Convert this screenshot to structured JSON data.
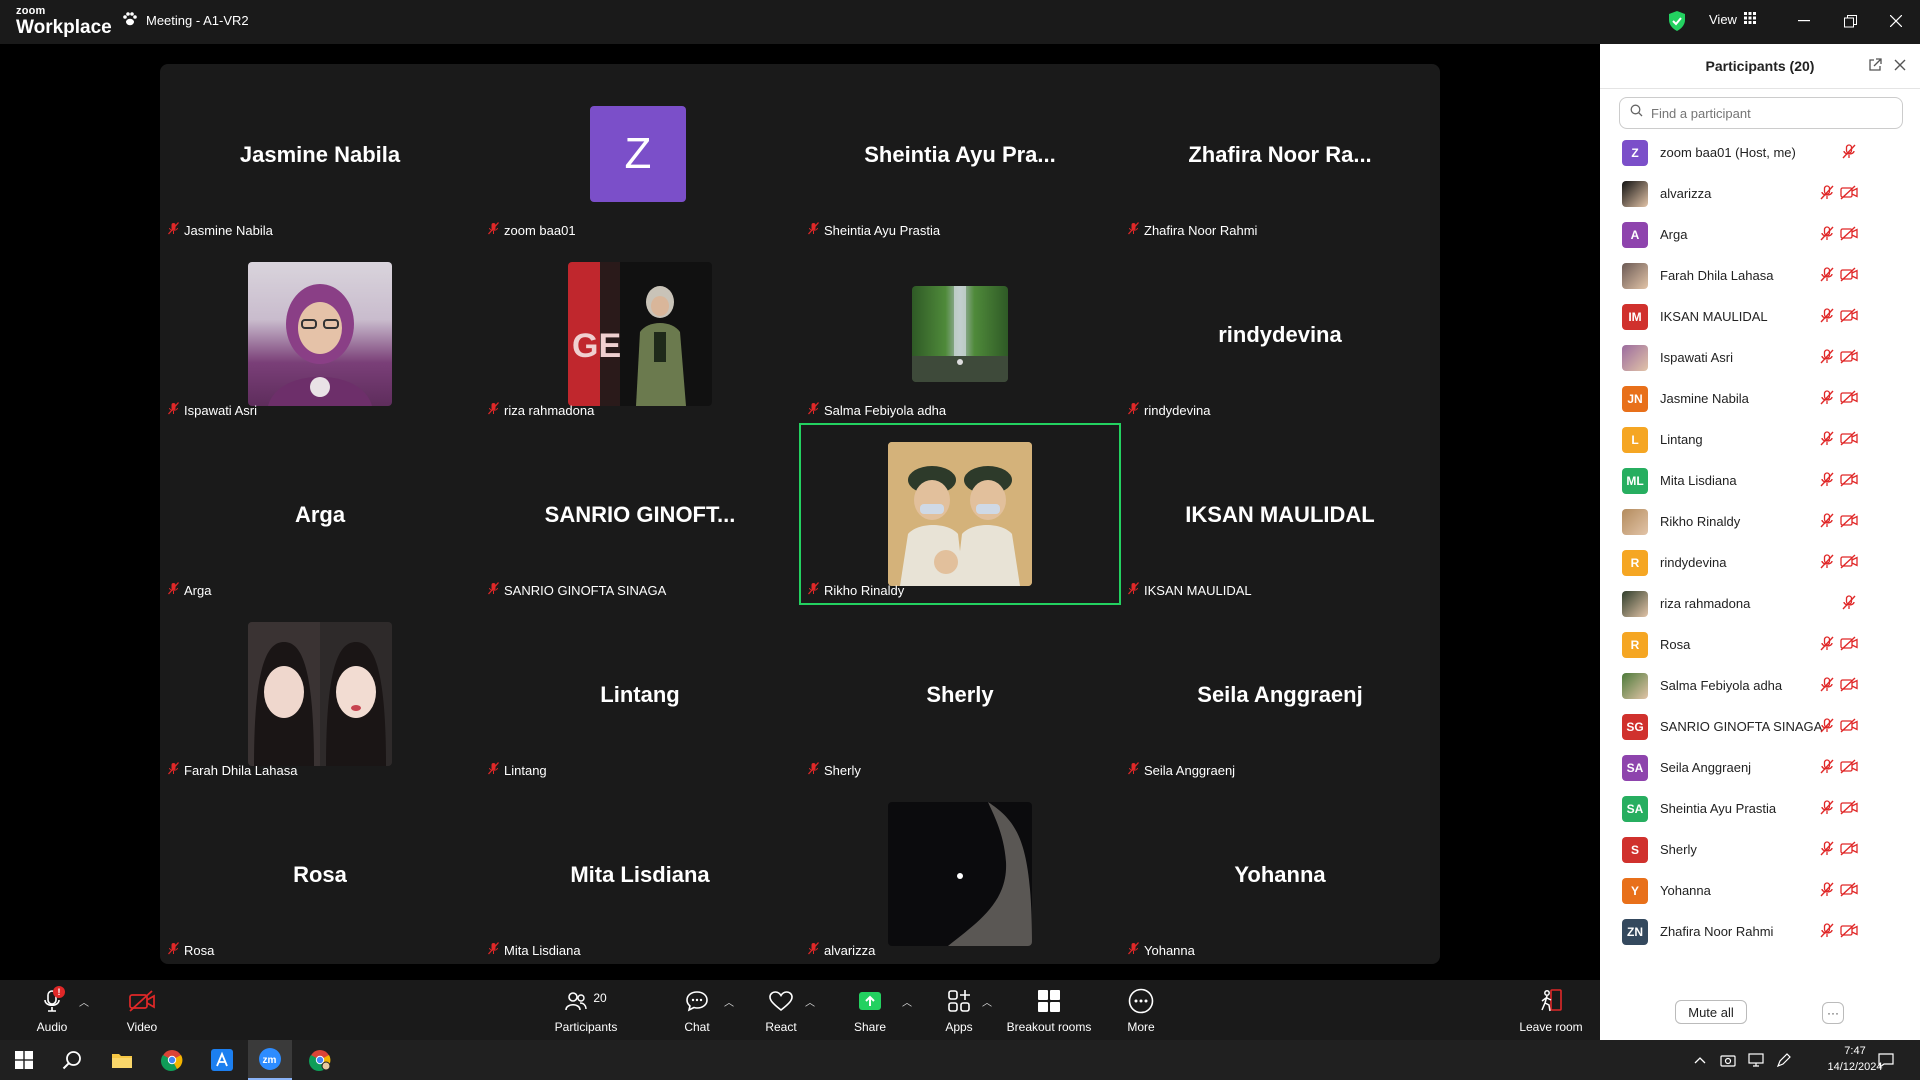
{
  "app": {
    "logo_line1": "zoom",
    "logo_line2": "Workplace",
    "meeting_title": "Meeting - A1-VR2",
    "view_label": "View"
  },
  "tiles": [
    {
      "big": "Jasmine Nabila",
      "label": "Jasmine Nabila"
    },
    {
      "big": "Z",
      "label": "zoom baa01",
      "avatar_color": "#7b4fc9"
    },
    {
      "big": "Sheintia Ayu Pra...",
      "label": "Sheintia Ayu Prastia"
    },
    {
      "big": "Zhafira Noor Ra...",
      "label": "Zhafira Noor Rahmi"
    },
    {
      "big": "",
      "label": "Ispawati Asri"
    },
    {
      "big": "",
      "label": "riza rahmadona"
    },
    {
      "big": "",
      "label": "Salma Febiyola adha"
    },
    {
      "big": "rindydevina",
      "label": "rindydevina"
    },
    {
      "big": "Arga",
      "label": "Arga"
    },
    {
      "big": "SANRIO GINOFT...",
      "label": "SANRIO GINOFTA SINAGA"
    },
    {
      "big": "",
      "label": "Rikho Rinaldy"
    },
    {
      "big": "IKSAN MAULIDAL",
      "label": "IKSAN MAULIDAL"
    },
    {
      "big": "",
      "label": "Farah Dhila Lahasa"
    },
    {
      "big": "Lintang",
      "label": "Lintang"
    },
    {
      "big": "Sherly",
      "label": "Sherly"
    },
    {
      "big": "Seila Anggraenj",
      "label": "Seila Anggraenj"
    },
    {
      "big": "Rosa",
      "label": "Rosa"
    },
    {
      "big": "Mita Lisdiana",
      "label": "Mita Lisdiana"
    },
    {
      "big": "",
      "label": "alvarizza"
    },
    {
      "big": "Yohanna",
      "label": "Yohanna"
    }
  ],
  "panel": {
    "title": "Participants (20)",
    "search_placeholder": "Find a participant",
    "mute_all": "Mute all",
    "more": "···",
    "participants": [
      {
        "initials": "Z",
        "name": "zoom baa01 (Host, me)",
        "color": "#7b4fc9",
        "photo": false,
        "cam_off": false
      },
      {
        "initials": "",
        "name": "alvarizza",
        "color": "#111111",
        "photo": true,
        "cam_off": true
      },
      {
        "initials": "A",
        "name": "Arga",
        "color": "#8e44ad",
        "photo": false,
        "cam_off": true
      },
      {
        "initials": "",
        "name": "Farah Dhila Lahasa",
        "color": "#6b5a55",
        "photo": true,
        "cam_off": true
      },
      {
        "initials": "IM",
        "name": "IKSAN MAULIDAL",
        "color": "#d0312d",
        "photo": false,
        "cam_off": true
      },
      {
        "initials": "",
        "name": "Ispawati Asri",
        "color": "#9b6b9e",
        "photo": true,
        "cam_off": true
      },
      {
        "initials": "JN",
        "name": "Jasmine Nabila",
        "color": "#e8701a",
        "photo": false,
        "cam_off": true
      },
      {
        "initials": "L",
        "name": "Lintang",
        "color": "#f5a623",
        "photo": false,
        "cam_off": true
      },
      {
        "initials": "ML",
        "name": "Mita Lisdiana",
        "color": "#27ae60",
        "photo": false,
        "cam_off": true
      },
      {
        "initials": "",
        "name": "Rikho Rinaldy",
        "color": "#b38b5d",
        "photo": true,
        "cam_off": true
      },
      {
        "initials": "R",
        "name": "rindydevina",
        "color": "#f5a623",
        "photo": false,
        "cam_off": true
      },
      {
        "initials": "",
        "name": "riza rahmadona",
        "color": "#2f3d2b",
        "photo": true,
        "cam_off": false
      },
      {
        "initials": "R",
        "name": "Rosa",
        "color": "#f5a623",
        "photo": false,
        "cam_off": true
      },
      {
        "initials": "",
        "name": "Salma Febiyola adha",
        "color": "#4c7a3a",
        "photo": true,
        "cam_off": true
      },
      {
        "initials": "SG",
        "name": "SANRIO GINOFTA SINAGA",
        "color": "#d0312d",
        "photo": false,
        "cam_off": true
      },
      {
        "initials": "SA",
        "name": "Seila Anggraenj",
        "color": "#8e44ad",
        "photo": false,
        "cam_off": true
      },
      {
        "initials": "SA",
        "name": "Sheintia Ayu Prastia",
        "color": "#27ae60",
        "photo": false,
        "cam_off": true
      },
      {
        "initials": "S",
        "name": "Sherly",
        "color": "#d0312d",
        "photo": false,
        "cam_off": true
      },
      {
        "initials": "Y",
        "name": "Yohanna",
        "color": "#e8701a",
        "photo": false,
        "cam_off": true
      },
      {
        "initials": "ZN",
        "name": "Zhafira Noor Rahmi",
        "color": "#34495e",
        "photo": false,
        "cam_off": true
      }
    ]
  },
  "toolbar": {
    "audio": "Audio",
    "audio_badge": "!",
    "video": "Video",
    "participants": "Participants",
    "participants_count": "20",
    "chat": "Chat",
    "react": "React",
    "share": "Share",
    "apps": "Apps",
    "breakout": "Breakout rooms",
    "more": "More",
    "leave": "Leave room"
  },
  "taskbar": {
    "time": "7:47",
    "date": "14/12/2024"
  },
  "colors": {
    "active_speaker": "#23d160",
    "share_green": "#23d160",
    "muted_red": "#e02828"
  }
}
